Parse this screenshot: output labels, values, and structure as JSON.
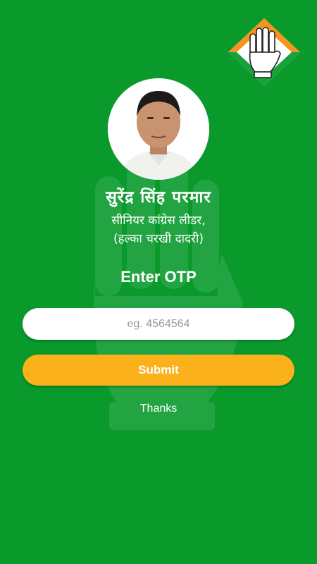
{
  "colors": {
    "background": "#0a9a2c",
    "submit_button": "#fbb11a",
    "input_background": "#ffffff",
    "text": "#ffffff"
  },
  "logo": {
    "icon": "congress-hand-icon"
  },
  "profile": {
    "avatar_icon": "profile-photo",
    "name": "सुरेंद्र सिंह परमार",
    "subtitle_line1": "सीनियर कांग्रेस लीडर,",
    "subtitle_line2": "(हल्का चरखी दादरी)"
  },
  "form": {
    "heading": "Enter OTP",
    "otp_input": {
      "value": "",
      "placeholder": "eg. 4564564"
    },
    "submit_label": "Submit",
    "footer_text": "Thanks"
  }
}
